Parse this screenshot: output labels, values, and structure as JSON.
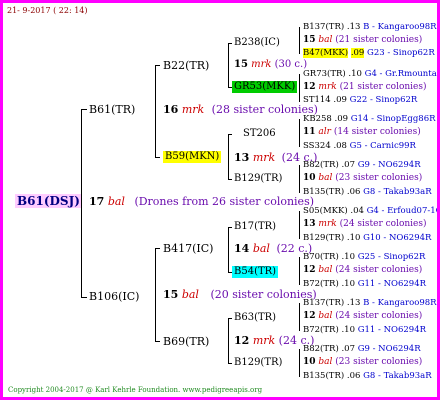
{
  "header": {
    "date": "21- 9-2017 ( 22: 14)"
  },
  "footer": {
    "copyright": "Copyright 2004-2017 @ Karl Kehrle Foundation.   www.pedigreeapis.org"
  },
  "root": {
    "name": "B61(DSJ)",
    "num": "17",
    "mark": "bal",
    "note": "(Drones from 26 sister colonies)"
  },
  "colors": {
    "magenta": "#ff00ff",
    "yellow": "#ffff00",
    "green": "#00cc00",
    "cyan": "#00ffff",
    "pink": "#ffccff"
  },
  "gen1": [
    {
      "name": "B61(TR)"
    },
    {
      "name": "B106(IC)"
    }
  ],
  "gen2": [
    {
      "name": "B22(TR)",
      "num": "16",
      "mark": "mrk",
      "note": "(28 sister colonies)"
    },
    {
      "name": "B59(MKN)",
      "num": "13",
      "mark": "mrk",
      "note": "(24 c.)"
    },
    {
      "name": "B417(IC)",
      "num": "14",
      "mark": "bal",
      "note": "(22 c.)"
    },
    {
      "name": "B69(TR)",
      "num": "15",
      "mark": "bal",
      "note": "(20 sister colonies)"
    }
  ],
  "gen3": [
    {
      "name": "B238(IC)",
      "num": "15",
      "mark": "mrk",
      "note": "(30 c.)"
    },
    {
      "name": "GR53(MKK)",
      "num": "12",
      "mark": "mrk",
      "note": "(21 sister colonies)"
    },
    {
      "name": "ST206",
      "num": "11",
      "mark": "alr",
      "note": "(14 sister colonies)"
    },
    {
      "name": "B129(TR)",
      "num": "10",
      "mark": "bal",
      "note": "(23 sister colonies)"
    },
    {
      "name": "B17(TR)",
      "num": "13",
      "mark": "mrk",
      "note": "(24 sister colonies)"
    },
    {
      "name": "B54(TR)",
      "num": "12",
      "mark": "bal",
      "note": "(24 sister colonies)"
    },
    {
      "name": "B63(TR)",
      "num": "12",
      "mark": "bal",
      "note": "(24 sister colonies)"
    },
    {
      "name": "B129(TR)",
      "num": "10",
      "mark": "bal",
      "note": "(23 sister colonies)"
    }
  ],
  "gen4": [
    {
      "name": "B137(TR)",
      "year": ".13",
      "loc": "B - Kangaroo98R"
    },
    {
      "name": "B47(MKK)",
      "year": ".09",
      "loc": "G23 - Sinop62R"
    },
    {
      "name": "GR73(TR)",
      "year": ".10",
      "loc": "G4 - Gr.Rmounta"
    },
    {
      "name": "ST114",
      "year": ".09",
      "loc": "G22 - Sinop62R"
    },
    {
      "name": "KB258",
      "year": ".09",
      "loc": "G14 - SinopEgg86R"
    },
    {
      "name": "SS324",
      "year": ".08",
      "loc": "G5 - Carnic99R"
    },
    {
      "name": "B82(TR)",
      "year": ".07",
      "loc": "G9 - NO6294R"
    },
    {
      "name": "B135(TR)",
      "year": ".06",
      "loc": "G8 - Takab93aR"
    },
    {
      "name": "S05(MKK)",
      "year": ".04",
      "loc": "G4 - Erfoud07-1Q"
    },
    {
      "name": "B129(TR)",
      "year": ".10",
      "loc": "G10 - NO6294R"
    },
    {
      "name": "B70(TR)",
      "year": ".10",
      "loc": "G25 - Sinop62R"
    },
    {
      "name": "B72(TR)",
      "year": ".10",
      "loc": "G11 - NO6294R"
    },
    {
      "name": "B137(TR)",
      "year": ".13",
      "loc": "B - Kangaroo98R"
    },
    {
      "name": "B72(TR)",
      "year": ".10",
      "loc": "G11 - NO6294R"
    },
    {
      "name": "B82(TR)",
      "year": ".07",
      "loc": "G9 - NO6294R"
    },
    {
      "name": "B135(TR)",
      "year": ".06",
      "loc": "G8 - Takab93aR"
    }
  ]
}
